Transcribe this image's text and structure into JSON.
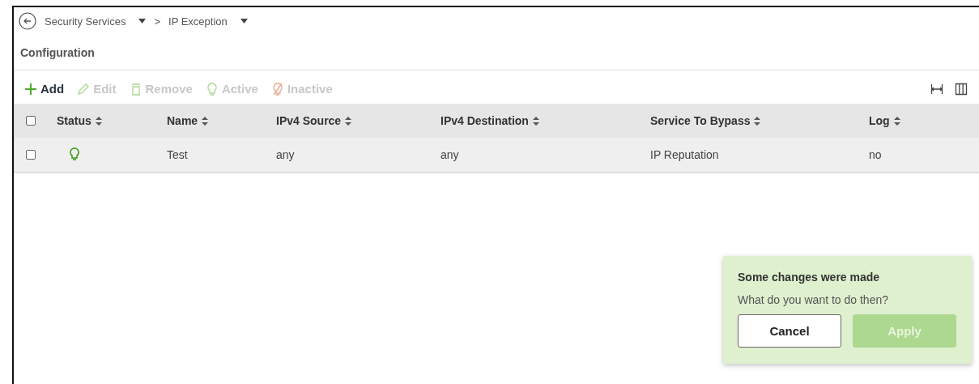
{
  "breadcrumb": [
    {
      "label": "Security Services"
    },
    {
      "label": "IP Exception"
    }
  ],
  "breadcrumb_separator": ">",
  "section_title": "Configuration",
  "toolbar": [
    {
      "kind": "add",
      "label": "Add",
      "disabled": false
    },
    {
      "kind": "edit",
      "label": "Edit",
      "disabled": true
    },
    {
      "kind": "remove",
      "label": "Remove",
      "disabled": true
    },
    {
      "kind": "active",
      "label": "Active",
      "disabled": true
    },
    {
      "kind": "inactive",
      "label": "Inactive",
      "disabled": true
    }
  ],
  "table": {
    "select_all_checked": false,
    "columns": [
      "Status",
      "Name",
      "IPv4 Source",
      "IPv4 Destination",
      "Service To Bypass",
      "Log"
    ],
    "rows": [
      {
        "checked": false,
        "status_active": true,
        "name": "Test",
        "ipv4_source": "any",
        "ipv4_destination": "any",
        "service_to_bypass": "IP Reputation",
        "log": "no"
      }
    ]
  },
  "toast": {
    "title": "Some changes were made",
    "message": "What do you want to do then?",
    "buttons": [
      {
        "label": "Cancel",
        "disabled": false
      },
      {
        "label": "Apply",
        "disabled": true
      }
    ]
  }
}
